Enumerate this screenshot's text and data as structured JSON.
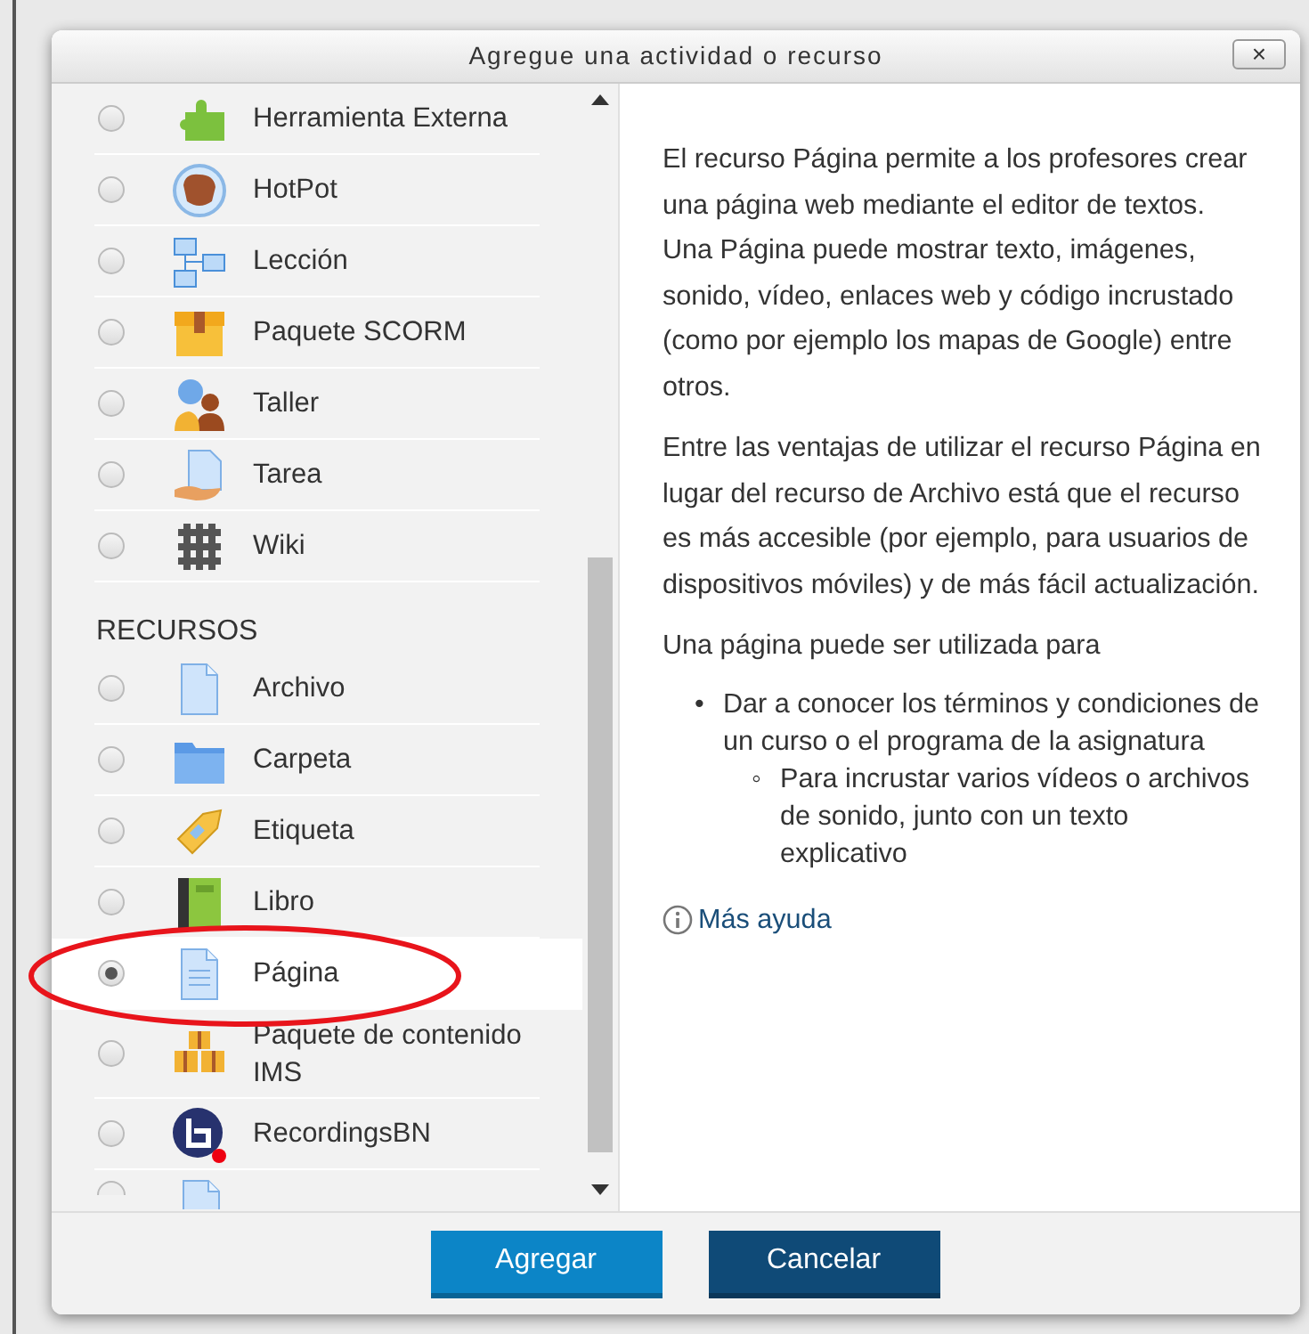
{
  "dialog": {
    "title": "Agregue una actividad o recurso",
    "close_label": "×"
  },
  "sections": [
    {
      "items": [
        {
          "label": "Herramienta Externa",
          "selected": false
        },
        {
          "label": "HotPot",
          "selected": false
        },
        {
          "label": "Lección",
          "selected": false
        },
        {
          "label": "Paquete SCORM",
          "selected": false
        },
        {
          "label": "Taller",
          "selected": false
        },
        {
          "label": "Tarea",
          "selected": false
        },
        {
          "label": "Wiki",
          "selected": false
        }
      ]
    },
    {
      "heading": "RECURSOS",
      "items": [
        {
          "label": "Archivo",
          "selected": false
        },
        {
          "label": "Carpeta",
          "selected": false
        },
        {
          "label": "Etiqueta",
          "selected": false
        },
        {
          "label": "Libro",
          "selected": false
        },
        {
          "label": "Página",
          "selected": true,
          "circled": true
        },
        {
          "label": "Paquete de contenido IMS",
          "selected": false
        },
        {
          "label": "RecordingsBN",
          "selected": false
        },
        {
          "kind": "partial",
          "selected": false
        }
      ]
    }
  ],
  "description": {
    "paragraphs": [
      "El recurso Página permite a los profesores crear una página web mediante el editor de textos. Una Página puede mostrar texto, imágenes, sonido, vídeo, enlaces web y código incrustado (como por ejemplo los mapas de Google) entre otros.",
      "Entre las ventajas de utilizar el recurso Página en lugar del recurso de Archivo está que el recurso es más accesible (por ejemplo, para usuarios de dispositivos móviles) y de más fácil actualización.",
      "Una página puede ser utilizada para"
    ],
    "bullets": [
      {
        "marker": "•",
        "text": "Dar a conocer los términos y condiciones de un curso o el programa de la asignatura",
        "children": [
          {
            "marker": "◦",
            "text": "Para incrustar varios vídeos o archivos de sonido, junto con un texto explicativo"
          }
        ]
      }
    ],
    "help_link": "Más ayuda"
  },
  "buttons": [
    {
      "label": "Agregar",
      "kind": "primary"
    },
    {
      "label": "Cancelar",
      "kind": "secondary"
    }
  ]
}
